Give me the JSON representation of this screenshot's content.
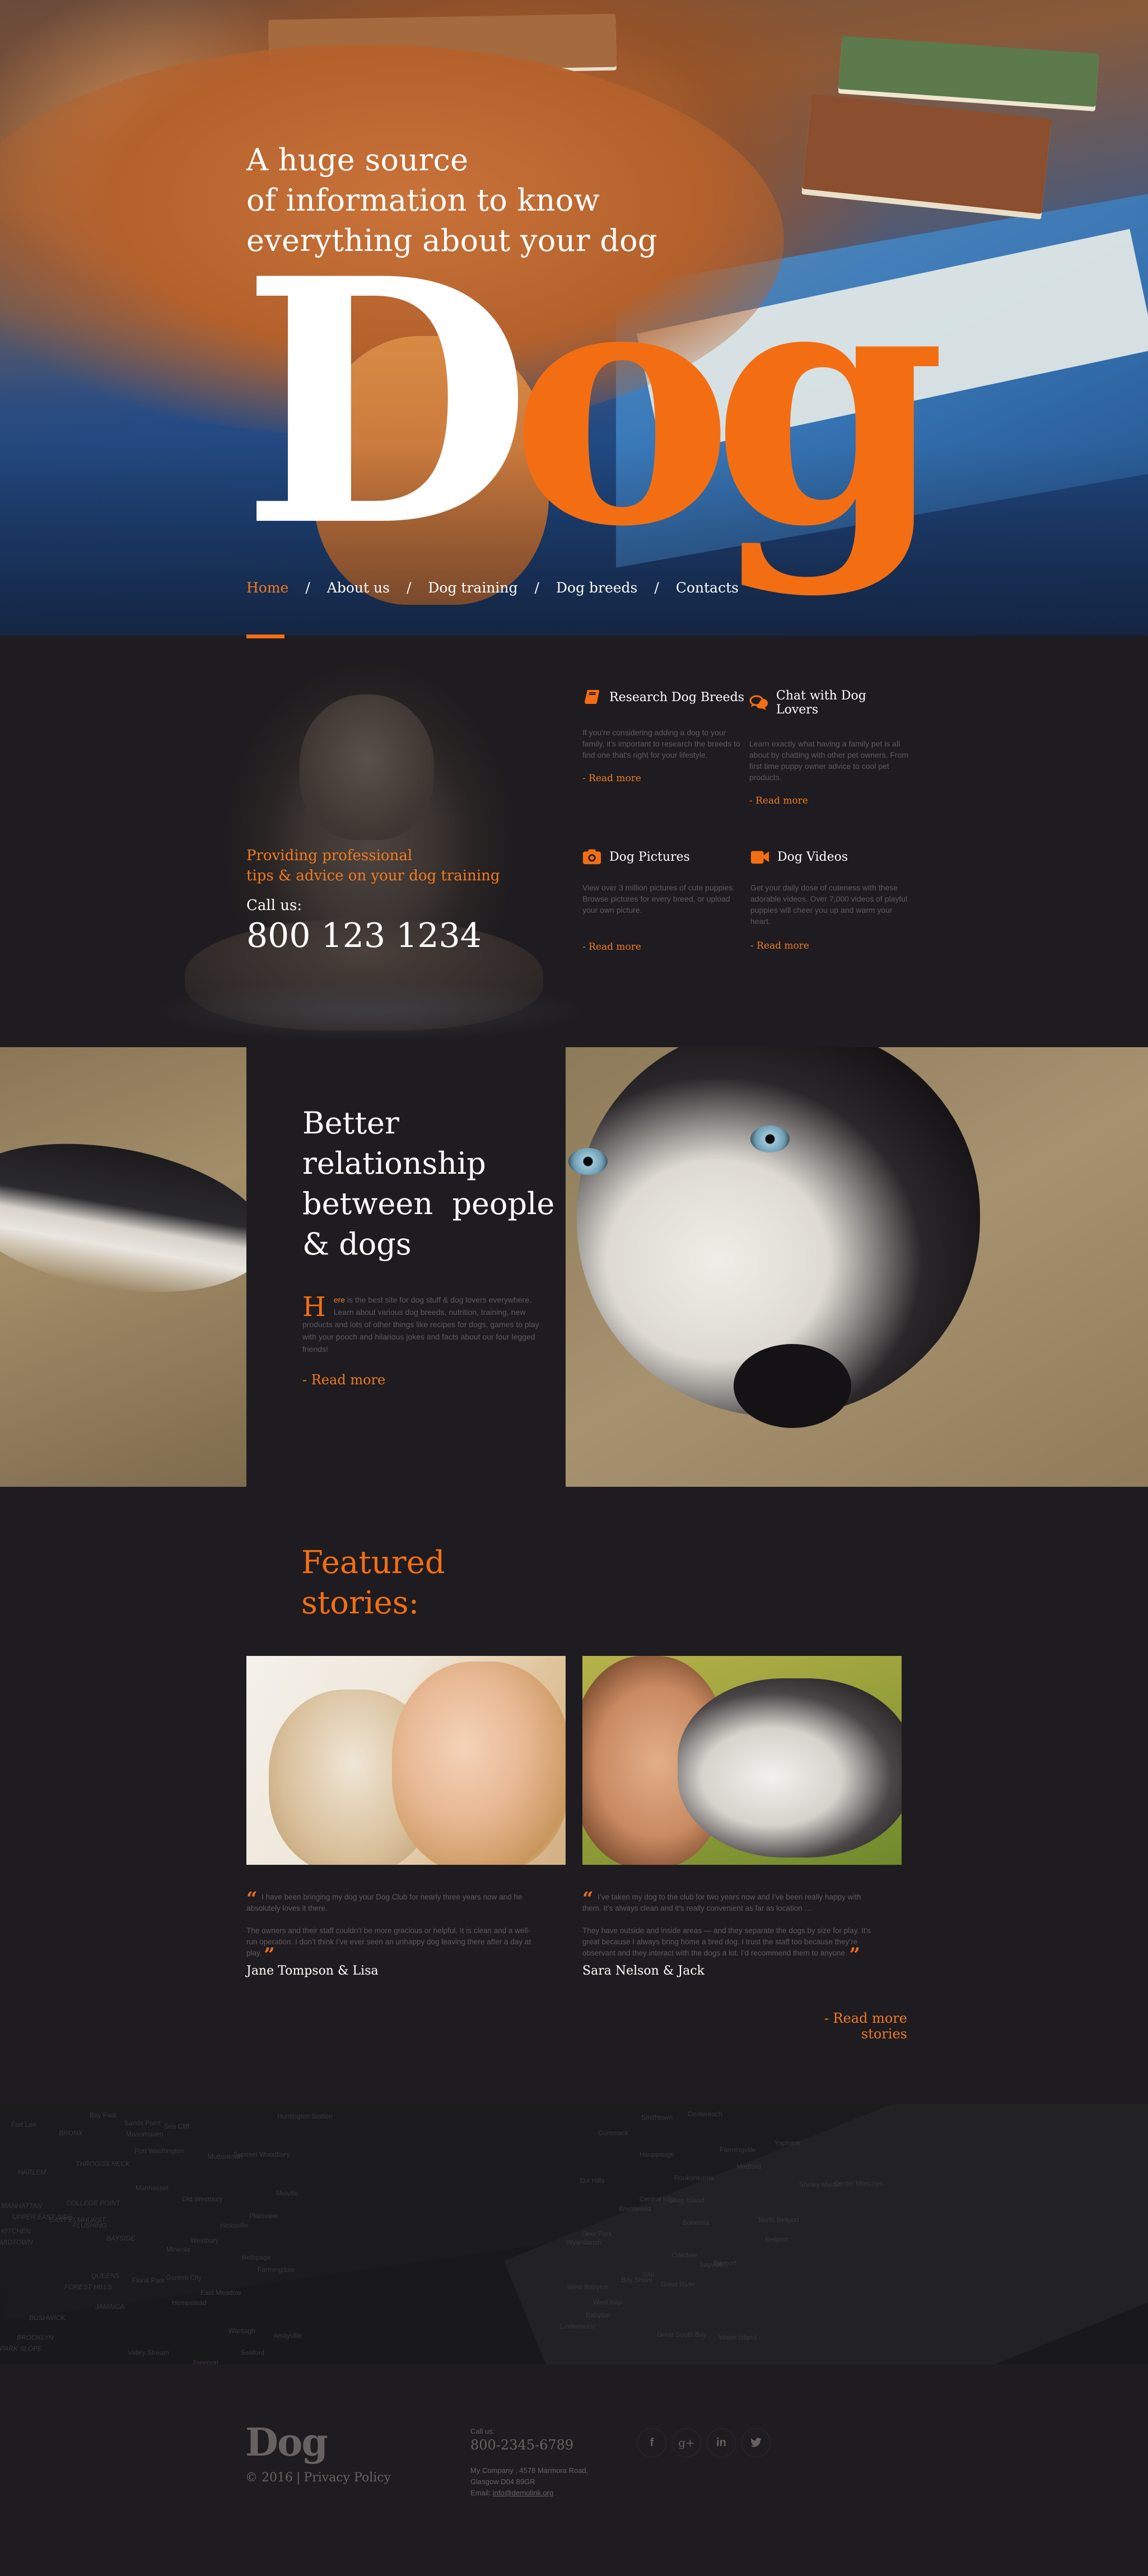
{
  "hero": {
    "tagline_lines": [
      "A huge source",
      "of information to know",
      "everything about your dog"
    ],
    "logo_first": "D",
    "logo_rest": "og"
  },
  "nav": {
    "items": [
      {
        "label": "Home",
        "active": true
      },
      {
        "label": "About us"
      },
      {
        "label": "Dog training"
      },
      {
        "label": "Dog breeds"
      },
      {
        "label": "Contacts"
      }
    ],
    "separator": "/"
  },
  "promo": {
    "tagline_lines": [
      "Providing professional",
      "tips & advice on your dog training"
    ],
    "call_label": "Call us:",
    "phone": "800 123 1234"
  },
  "features": [
    {
      "icon": "book-icon",
      "title": "Research Dog Breeds",
      "description": "If you're considering adding a dog to your family, it's important to research the breeds to find one that's right for your lifestyle.",
      "link": "- Read more"
    },
    {
      "icon": "chat-bubbles-icon",
      "title": "Chat with Dog Lovers",
      "description": "Learn exactly what having a family pet is all about by chatting with other pet owners. From first time puppy owner advice to cool pet products.",
      "link": "- Read more"
    },
    {
      "icon": "camera-icon",
      "title": "Dog Pictures",
      "description": "View over 3 million pictures of cute puppies. Browse pictures for every breed, or upload your own picture.",
      "link": "- Read more"
    },
    {
      "icon": "video-camera-icon",
      "title": "Dog Videos",
      "description": "Get your daily dose of cuteness with these adorable videos. Over 7,000 videos of playful puppies will cheer you up and warm your heart.",
      "link": "- Read more"
    }
  ],
  "relationship": {
    "title_lines": [
      "Better",
      "relationship",
      "between  people",
      "& dogs"
    ],
    "drop_cap": "H",
    "drop_rest": "ere",
    "text": " is the best site for dog stuff & dog lovers everywhere. Learn about various dog breeds, nutrition, training, new products and lots of other things like recipes for dogs, games to play with your pooch and hilarious jokes and facts about our four legged friends!",
    "link": "- Read more"
  },
  "featured": {
    "title_lines": [
      "Featured",
      "stories:"
    ],
    "stories": [
      {
        "paragraphs": [
          "I have been bringing my dog your Dog Club for nearly three years now and he absolutely loves it there.",
          "The owners and their staff couldn’t be more gracious or helpful. It is clean and a well-run operation. I don’t think I’ve ever seen an unhappy dog leaving there after a day at play."
        ],
        "author": "Jane Tompson & Lisa"
      },
      {
        "paragraphs": [
          "I’ve taken my dog to the club for two years now and I’ve been really happy with them. It’s always clean and it’s really convenient as far as location …",
          "They have outside and inside areas — and they separate the dogs by size for play. It’s great because I always bring home a tired dog. I trust the staff too because they’re observant and they interact with the dogs a lot. I’d recommend them to anyone."
        ],
        "author": "Sara Nelson & Jack"
      }
    ],
    "open_quote": "“",
    "close_quote": "”",
    "more_link": "- Read more stories"
  },
  "map": {
    "labels": [
      "Fort Lee",
      "BRONX",
      "HARLEM",
      "MANHATTAN",
      "UPPER EAST SIDE",
      "KITCHEN",
      "MIDTOWN",
      "THROGGS NECK",
      "COLLEGE POINT",
      "EAST ELMHURST",
      "FLUSHING",
      "BAYSIDE",
      "QUEENS",
      "FOREST HILLS",
      "JAMAICA",
      "BUSHWICK",
      "BROOKLYN",
      "PARK SLOPE",
      "Bay Park",
      "Sands Point",
      "Manorhaven",
      "Port Washington",
      "Sea Cliff",
      "Manhasset",
      "Old Westbury",
      "Mineola",
      "Westbury",
      "Garden City",
      "Floral Park",
      "Hempstead",
      "East Meadow",
      "Valley Stream",
      "Freeport",
      "Muttontown",
      "Syosset Woodbury",
      "Hicksville",
      "Plainview",
      "Bethpage",
      "Farmingdale",
      "Wantagh",
      "Seaford",
      "Amityville",
      "Melville",
      "Huntington Station",
      "Smithtown",
      "Centereach",
      "Commack",
      "Hauppauge",
      "Dix Hills",
      "Brentwood",
      "Central Islip",
      "Ronkonkoma",
      "Long Island",
      "Bohemia",
      "Deer Park",
      "Wyandanch",
      "West Babylon",
      "West Islip",
      "Babylon",
      "Lindenhurst",
      "Bay Shore",
      "Islip",
      "Great River",
      "Oakdale",
      "Sayville",
      "Bayport",
      "Farmingville",
      "Medford",
      "Yaphank",
      "North Bellport",
      "Bellport",
      "Shirley Mastic",
      "Center Moriches",
      "Great South Bay",
      "Water Island",
      "Gilgo-Oak"
    ]
  },
  "footer": {
    "logo": "Dog",
    "copyright": "© 2016",
    "privacy": "Privacy Policy",
    "call_label": "Call us:",
    "phone": "800-2345-6789",
    "address_line1": "My Company , 4578 Marmora Road,",
    "address_line2": "Glasgow D04 89GR",
    "email_label": "Email:",
    "email": "info@demolink.org",
    "social": [
      {
        "name": "facebook",
        "glyph": "f"
      },
      {
        "name": "google-plus",
        "glyph": "g+"
      },
      {
        "name": "linkedin",
        "glyph": "in"
      },
      {
        "name": "twitter",
        "glyph": "🐦"
      }
    ]
  },
  "colors": {
    "accent": "#f36e13",
    "background": "#1e1c20",
    "muted_text": "#5e5a5f",
    "footer_text": "#686162"
  }
}
